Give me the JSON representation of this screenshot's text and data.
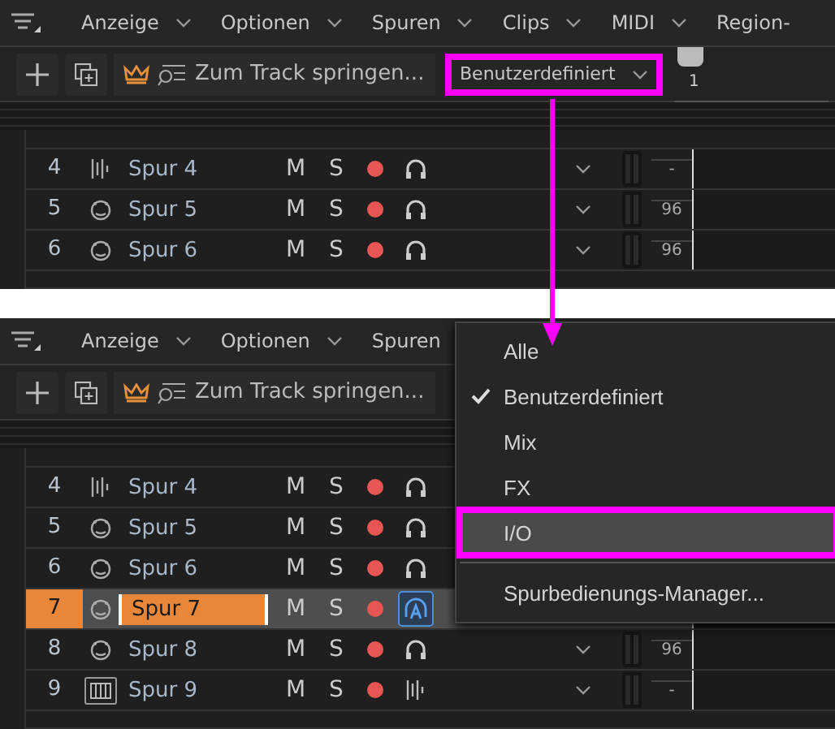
{
  "panels": [
    {
      "menubar": [
        {
          "label": "Anzeige",
          "chevron": true
        },
        {
          "label": "Optionen",
          "chevron": true
        },
        {
          "label": "Spuren",
          "chevron": true
        },
        {
          "label": "Clips",
          "chevron": true
        },
        {
          "label": "MIDI",
          "chevron": true
        },
        {
          "label": "Region-",
          "chevron": false
        }
      ],
      "toolbar": {
        "search": "Zum Track springen...",
        "preset": {
          "label": "Benutzerdefiniert",
          "annotated": true
        }
      },
      "ruler": {
        "label": "1"
      },
      "tracks": [
        {
          "number": "4",
          "kind": "audio",
          "name": "Spur 4",
          "mute": "M",
          "solo": "S",
          "monitor": {
            "kind": "headphones"
          },
          "selected": false,
          "chevron": true,
          "value": "-"
        },
        {
          "number": "5",
          "kind": "instrument",
          "name": "Spur 5",
          "mute": "M",
          "solo": "S",
          "monitor": {
            "kind": "headphones"
          },
          "selected": false,
          "chevron": true,
          "value": "96"
        },
        {
          "number": "6",
          "kind": "instrument",
          "name": "Spur 6",
          "mute": "M",
          "solo": "S",
          "monitor": {
            "kind": "headphones"
          },
          "selected": false,
          "chevron": true,
          "value": "96"
        }
      ]
    },
    {
      "menubar": [
        {
          "label": "Anzeige",
          "chevron": true
        },
        {
          "label": "Optionen",
          "chevron": true
        },
        {
          "label": "Spuren",
          "chevron": false
        }
      ],
      "toolbar": {
        "search": "Zum Track springen..."
      },
      "tracks": [
        {
          "number": "4",
          "kind": "audio",
          "name": "Spur 4",
          "mute": "M",
          "solo": "S",
          "monitor": {
            "kind": "headphones"
          },
          "selected": false
        },
        {
          "number": "5",
          "kind": "instrument",
          "name": "Spur 5",
          "mute": "M",
          "solo": "S",
          "monitor": {
            "kind": "headphones"
          },
          "selected": false
        },
        {
          "number": "6",
          "kind": "instrument",
          "name": "Spur 6",
          "mute": "M",
          "solo": "S",
          "monitor": {
            "kind": "headphones"
          },
          "selected": false
        },
        {
          "number": "7",
          "kind": "instrument",
          "name": "Spur 7",
          "mute": "M",
          "solo": "S",
          "monitor": {
            "kind": "auto"
          },
          "selected": true
        },
        {
          "number": "8",
          "kind": "instrument",
          "name": "Spur 8",
          "mute": "M",
          "solo": "S",
          "monitor": {
            "kind": "headphones"
          },
          "selected": false,
          "chevron": true,
          "value": "96"
        },
        {
          "number": "9",
          "kind": "piano",
          "name": "Spur 9",
          "mute": "M",
          "solo": "S",
          "monitor": {
            "kind": "wave"
          },
          "selected": false,
          "chevron": true,
          "value": "-"
        }
      ],
      "menu": {
        "items": [
          {
            "kind": "item",
            "label": "Alle",
            "checked": false,
            "hovered": false,
            "annotated": false
          },
          {
            "kind": "item",
            "label": "Benutzerdefiniert",
            "checked": true,
            "hovered": false,
            "annotated": false
          },
          {
            "kind": "item",
            "label": "Mix",
            "checked": false,
            "hovered": false,
            "annotated": false
          },
          {
            "kind": "item",
            "label": "FX",
            "checked": false,
            "hovered": false,
            "annotated": false
          },
          {
            "kind": "item",
            "label": "I/O",
            "checked": false,
            "hovered": true,
            "annotated": true
          },
          {
            "kind": "separator"
          },
          {
            "kind": "item",
            "label": "Spurbedienungs-Manager...",
            "checked": false,
            "hovered": false,
            "annotated": false
          }
        ]
      }
    }
  ]
}
